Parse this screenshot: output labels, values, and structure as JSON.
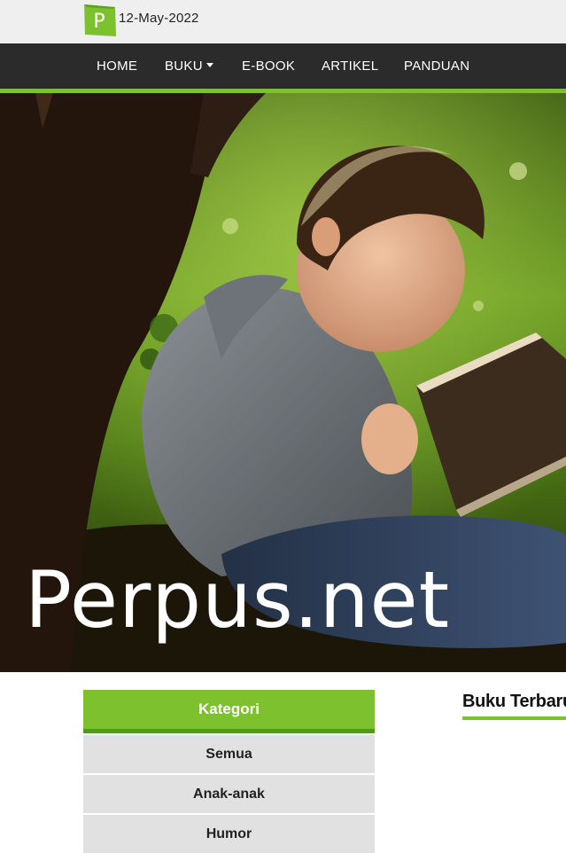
{
  "header": {
    "logo_letter": "P",
    "date": "12-May-2022"
  },
  "nav": {
    "items": [
      {
        "label": "HOME"
      },
      {
        "label": "BUKU",
        "has_dropdown": true
      },
      {
        "label": "E-BOOK"
      },
      {
        "label": "ARTIKEL"
      },
      {
        "label": "PANDUAN"
      }
    ]
  },
  "hero": {
    "title": "Perpus.net"
  },
  "categories": {
    "header": "Kategori",
    "items": [
      {
        "label": "Semua"
      },
      {
        "label": "Anak-anak"
      },
      {
        "label": "Humor"
      }
    ]
  },
  "main": {
    "section_title": "Buku Terbaru"
  },
  "colors": {
    "accent": "#7dc12f",
    "nav_bg": "#2b2b2b",
    "topbar_bg": "#efefef",
    "category_item_bg": "#e1e1e1"
  }
}
